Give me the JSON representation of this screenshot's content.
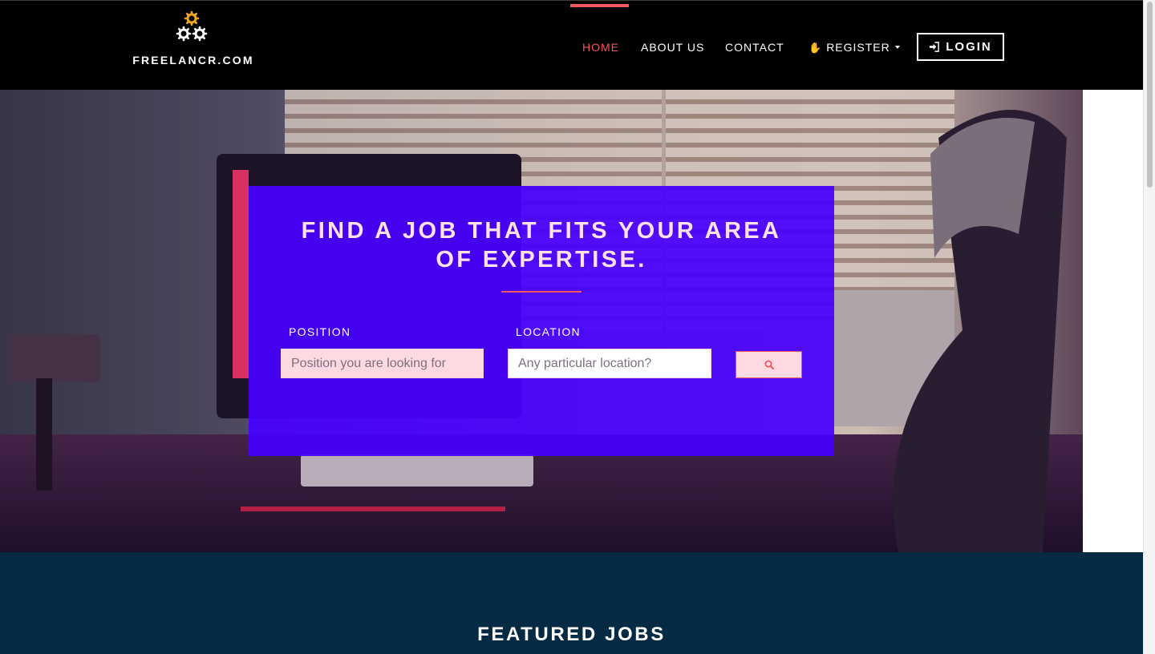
{
  "brand": {
    "name": "FREELANCR.COM",
    "icon": "gears-icon",
    "colors": {
      "gear_gold": "#f5a623",
      "gear_white": "#ffffff"
    }
  },
  "nav": {
    "items": [
      {
        "label": "HOME",
        "active": true
      },
      {
        "label": "ABOUT US",
        "active": false
      },
      {
        "label": "CONTACT",
        "active": false
      },
      {
        "label": "REGISTER",
        "active": false,
        "icon": "hand-icon",
        "dropdown": true
      }
    ],
    "login_label": "LOGIN",
    "login_icon": "sign-in-icon",
    "colors": {
      "background": "#000000",
      "active": "#f2575f",
      "text": "#ffffff"
    }
  },
  "hero": {
    "title": "FIND A JOB THAT FITS YOUR AREA OF EXPERTISE.",
    "position_label": "POSITION",
    "position_placeholder": "Position you are looking for",
    "position_value": "",
    "location_label": "LOCATION",
    "location_placeholder": "Any particular location?",
    "location_value": "",
    "search_icon": "search-icon",
    "colors": {
      "panel": "#4600ff",
      "accent": "#f2575f",
      "title": "#ffe2ea"
    }
  },
  "featured": {
    "title": "FEATURED JOBS",
    "colors": {
      "background": "#042a44"
    }
  }
}
